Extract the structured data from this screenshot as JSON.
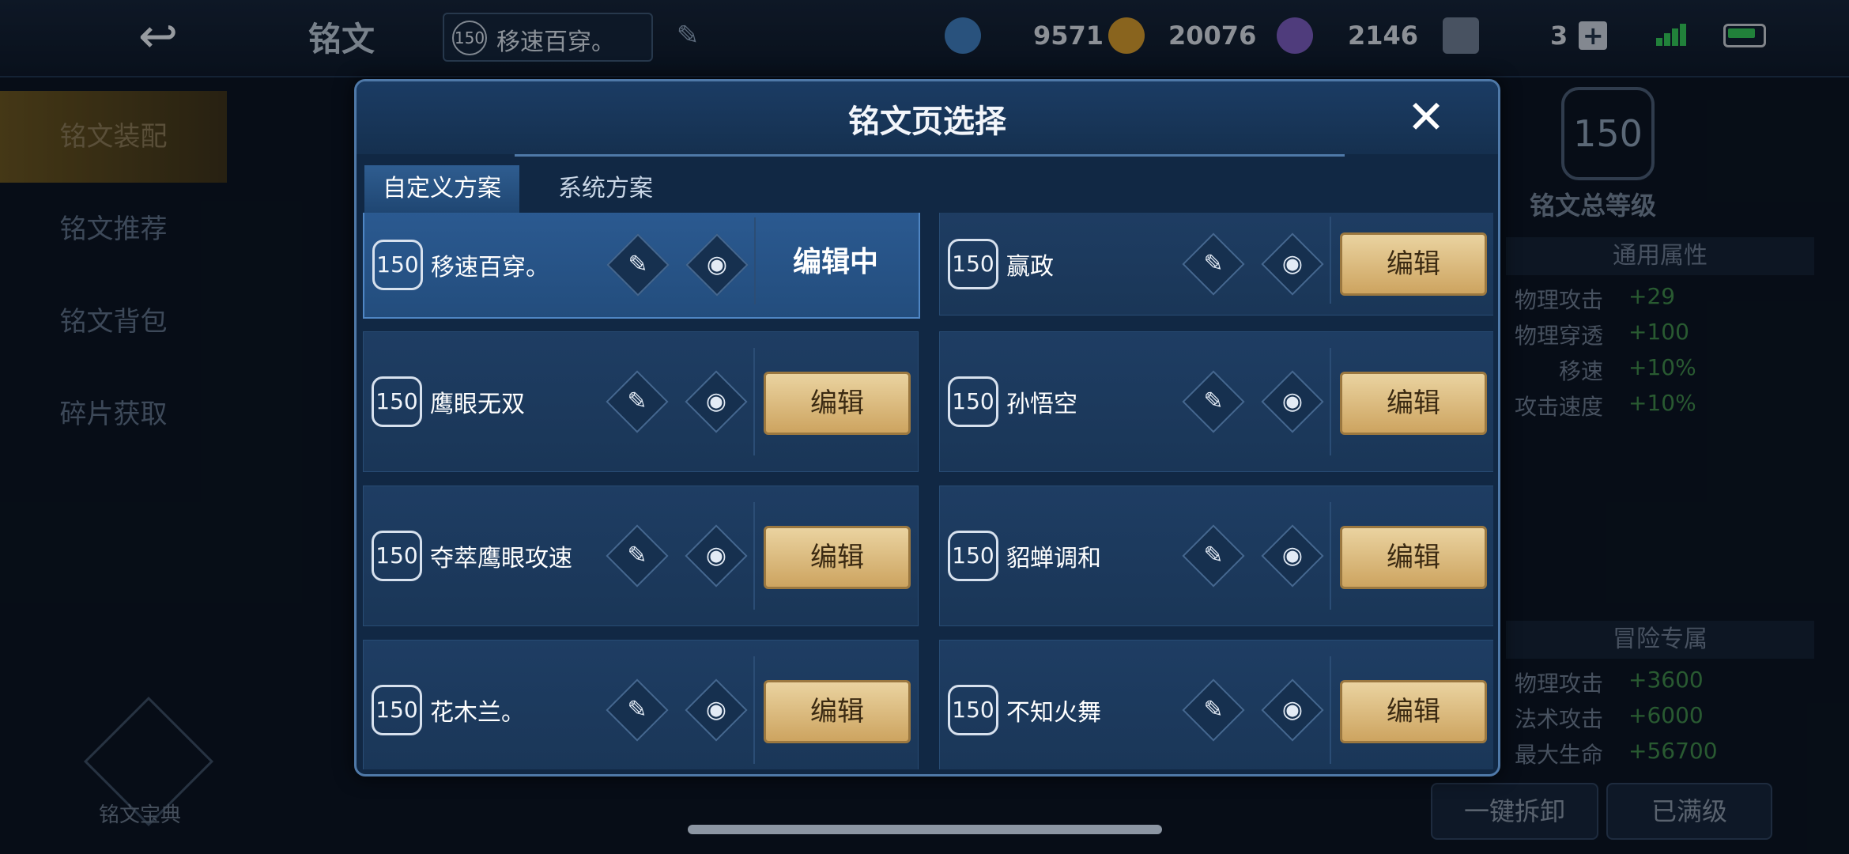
{
  "header": {
    "page_name": "铭文",
    "current_page_level": "150",
    "current_page_name": "移速百穿。",
    "resources": [
      {
        "icon": "gem-icon",
        "value": "9571",
        "color": "#5aa0e0"
      },
      {
        "icon": "gold-coin-icon",
        "value": "20076",
        "color": "#d8a53a"
      },
      {
        "icon": "crystal-icon",
        "value": "2146",
        "color": "#9a7ad8"
      },
      {
        "icon": "card-icon",
        "value": "3",
        "color": "#8c9bb0"
      }
    ]
  },
  "sidebar": {
    "items": [
      {
        "label": "铭文装配"
      },
      {
        "label": "铭文推荐"
      },
      {
        "label": "铭文背包"
      },
      {
        "label": "碎片获取"
      }
    ],
    "book_label": "铭文宝典"
  },
  "right_panel": {
    "total_level": "150",
    "total_level_label": "铭文总等级",
    "general_section": "通用属性",
    "general_attrs": [
      {
        "key": "物理攻击",
        "value": "+29"
      },
      {
        "key": "物理穿透",
        "value": "+100"
      },
      {
        "key": "移速",
        "value": "+10%"
      },
      {
        "key": "攻击速度",
        "value": "+10%"
      }
    ],
    "adventure_section": "冒险专属",
    "adventure_attrs": [
      {
        "key": "物理攻击",
        "value": "+3600"
      },
      {
        "key": "法术攻击",
        "value": "+6000"
      },
      {
        "key": "最大生命",
        "value": "+56700"
      }
    ],
    "btn_unload": "一键拆卸",
    "btn_full": "已满级"
  },
  "dialog": {
    "title": "铭文页选择",
    "tabs": {
      "custom": "自定义方案",
      "system": "系统方案"
    },
    "edit_label": "编辑",
    "editing_label": "编辑中",
    "pages": [
      {
        "level": "150",
        "name": "移速百穿。",
        "editing": true
      },
      {
        "level": "150",
        "name": "赢政",
        "editing": false
      },
      {
        "level": "150",
        "name": "鹰眼无双",
        "editing": false
      },
      {
        "level": "150",
        "name": "孙悟空",
        "editing": false
      },
      {
        "level": "150",
        "name": "夺萃鹰眼攻速",
        "editing": false
      },
      {
        "level": "150",
        "name": "貂蝉调和",
        "editing": false
      },
      {
        "level": "150",
        "name": "花木兰。",
        "editing": false
      },
      {
        "level": "150",
        "name": "不知火舞",
        "editing": false
      }
    ]
  }
}
